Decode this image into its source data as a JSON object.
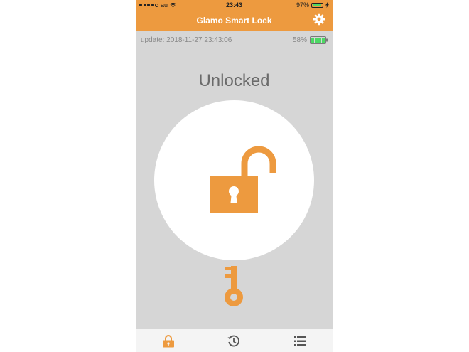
{
  "status_bar": {
    "carrier": "au",
    "time": "23:43",
    "battery": "97%"
  },
  "header": {
    "title": "Glamo Smart Lock",
    "settings_icon": "gear-icon"
  },
  "info": {
    "update": "update: 2018-11-27 23:43:06",
    "battery_percent": "58%",
    "battery_level": 0.58
  },
  "lock": {
    "state": "Unlocked",
    "icon": "open-padlock-icon",
    "key_icon": "key-icon"
  },
  "tabs": [
    {
      "icon": "lock-icon",
      "active": true
    },
    {
      "icon": "history-icon",
      "active": false
    },
    {
      "icon": "list-icon",
      "active": false
    }
  ],
  "colors": {
    "accent": "#ed9a3f",
    "background": "#d6d6d6",
    "battery_green": "#4cd964"
  }
}
